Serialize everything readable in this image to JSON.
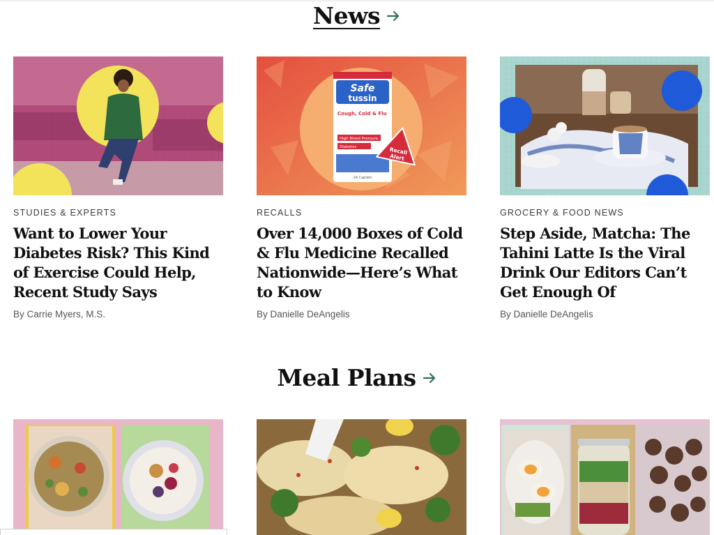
{
  "sections": {
    "news_title": "News",
    "meal_plans_title": "Meal Plans"
  },
  "news": [
    {
      "kicker": "STUDIES & EXPERTS",
      "headline": "Want to Lower Your Diabetes Risk? This Kind of Exercise Could Help, Recent Study Says",
      "byline": "By Carrie Myers, M.S."
    },
    {
      "kicker": "RECALLS",
      "headline": "Over 14,000 Boxes of Cold & Flu Medicine Recalled Nationwide—Here’s What to Know",
      "byline": "By Danielle DeAngelis",
      "image_text": {
        "brand_top": "Safe",
        "brand_bottom": "tussin",
        "product": "Cough, Cold & Flu",
        "hbp": "High Blood Pressure",
        "diabetes": "Diabetes",
        "count": "24 Caplets",
        "badge_line1": "Recall",
        "badge_line2": "Alert"
      }
    },
    {
      "kicker": "GROCERY & FOOD NEWS",
      "headline": "Step Aside, Matcha: The Tahini Latte Is the Viral Drink Our Editors Can’t Get Enough Of",
      "byline": "By Danielle DeAngelis"
    }
  ],
  "colors": {
    "accent_arrow": "#2f6f5b",
    "yellow_circle": "#f3e35a",
    "blue_circle": "#1f5bd8",
    "recall_red": "#d62b3a"
  }
}
